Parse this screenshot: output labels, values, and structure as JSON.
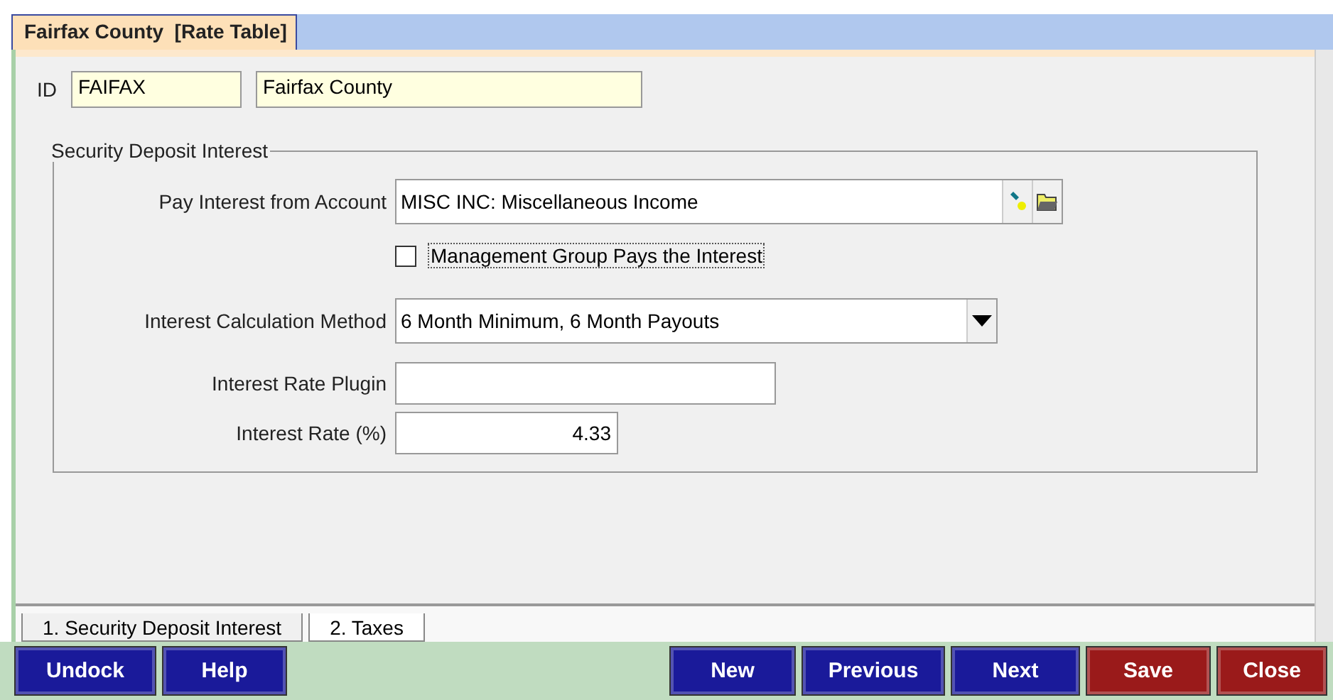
{
  "header_tab": {
    "title": "Fairfax County  [Rate Table]"
  },
  "id_row": {
    "label": "ID",
    "code": "FAIFAX",
    "name": "Fairfax County"
  },
  "group": {
    "title": "Security Deposit Interest",
    "fields": [
      {
        "kind": "lookup",
        "label": "Pay Interest from Account",
        "value": "MISC INC: Miscellaneous Income"
      },
      {
        "kind": "checkbox",
        "label": "Management Group Pays the Interest",
        "checked": false
      },
      {
        "kind": "dropdown",
        "label": "Interest Calculation Method",
        "value": "6 Month Minimum, 6 Month Payouts"
      },
      {
        "kind": "text",
        "label": "Interest Rate Plugin"
      },
      {
        "kind": "number",
        "label": "Interest Rate (%)",
        "value": "4.33"
      }
    ]
  },
  "tabs": [
    {
      "label": "1. Security Deposit Interest",
      "selected": true
    },
    {
      "label": "2. Taxes",
      "selected": false
    }
  ],
  "left_buttons": [
    {
      "label": "Undock",
      "color": "#1a1a9a"
    },
    {
      "label": "Help",
      "color": "#1a1a9a"
    }
  ],
  "right_buttons": [
    {
      "label": "New",
      "color": "#1a1a9a"
    },
    {
      "label": "Previous",
      "color": "#1a1a9a"
    },
    {
      "label": "Next",
      "color": "#1a1a9a"
    },
    {
      "label": "Save",
      "color": "#9a1a1a"
    },
    {
      "label": "Close",
      "color": "#9a1a1a"
    }
  ]
}
